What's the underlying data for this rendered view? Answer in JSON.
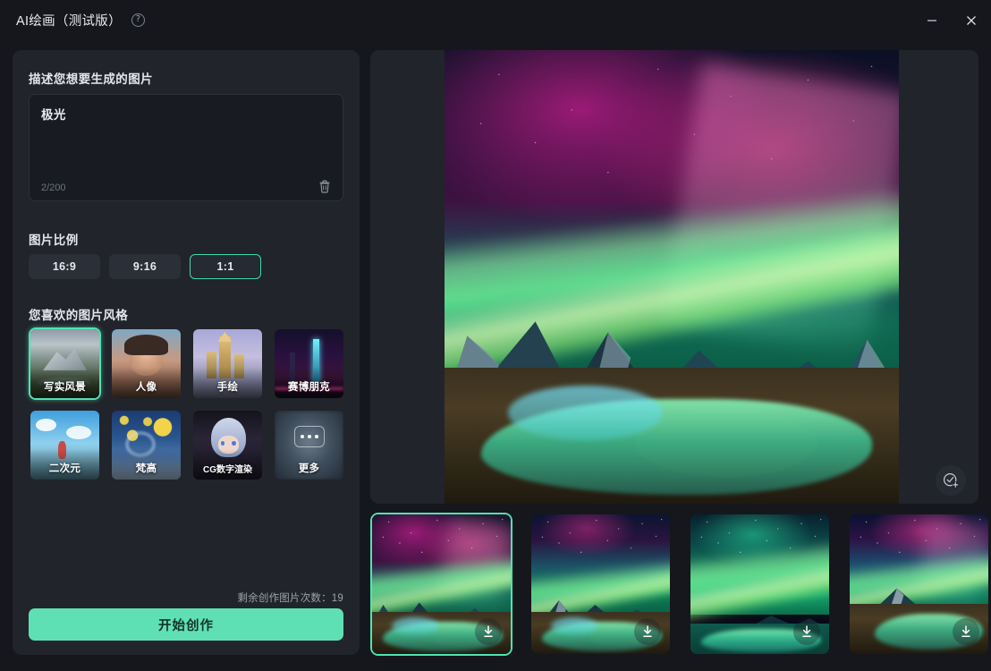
{
  "window": {
    "title": "AI绘画（测试版）",
    "help_icon": "question-circle-icon",
    "minimize_label": "−",
    "close_label": "✕"
  },
  "left_panel": {
    "prompt": {
      "label": "描述您想要生成的图片",
      "value": "极光",
      "placeholder": "描述您想要生成的图片",
      "counter": "2/200",
      "clear_icon": "trash-icon"
    },
    "ratio": {
      "label": "图片比例",
      "options": [
        {
          "label": "16:9",
          "selected": false
        },
        {
          "label": "9:16",
          "selected": false
        },
        {
          "label": "1:1",
          "selected": true
        }
      ]
    },
    "style": {
      "label": "您喜欢的图片风格",
      "options": [
        {
          "label": "写实风景",
          "selected": true,
          "art": "v1"
        },
        {
          "label": "人像",
          "selected": false,
          "art": "portrait"
        },
        {
          "label": "手绘",
          "selected": false,
          "art": "castle"
        },
        {
          "label": "赛博朋克",
          "selected": false,
          "art": "cyber"
        },
        {
          "label": "二次元",
          "selected": false,
          "art": "anime"
        },
        {
          "label": "梵高",
          "selected": false,
          "art": "vangogh"
        },
        {
          "label": "CG数字渲染",
          "selected": false,
          "art": "cg"
        },
        {
          "label": "更多",
          "selected": false,
          "art": "more"
        }
      ]
    },
    "footer": {
      "remaining_text": "剩余创作图片次数：19",
      "create_label": "开始创作"
    }
  },
  "preview": {
    "favorite_icon": "check-circle-plus-icon",
    "image_alt": "极光"
  },
  "thumbnails": [
    {
      "selected": true,
      "download_icon": "download-icon",
      "variant": "v1"
    },
    {
      "selected": false,
      "download_icon": "download-icon",
      "variant": "v2"
    },
    {
      "selected": false,
      "download_icon": "download-icon",
      "variant": "v3"
    },
    {
      "selected": false,
      "download_icon": "download-icon",
      "variant": "v4"
    }
  ],
  "colors": {
    "accent": "#4fe3b4",
    "button": "#5fe0b4",
    "panel": "#21242b",
    "window_bg": "#15171c",
    "input_bg": "#181b21"
  }
}
